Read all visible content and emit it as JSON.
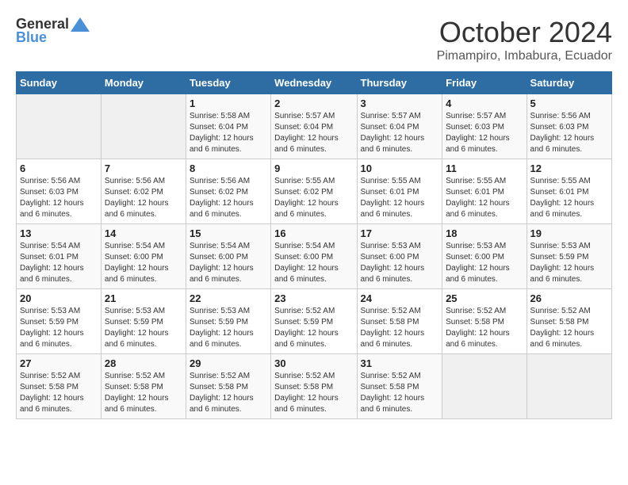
{
  "logo": {
    "general": "General",
    "blue": "Blue"
  },
  "title": "October 2024",
  "location": "Pimampiro, Imbabura, Ecuador",
  "days_header": [
    "Sunday",
    "Monday",
    "Tuesday",
    "Wednesday",
    "Thursday",
    "Friday",
    "Saturday"
  ],
  "weeks": [
    [
      {
        "day": "",
        "empty": true
      },
      {
        "day": "",
        "empty": true
      },
      {
        "day": "1",
        "sunrise": "Sunrise: 5:58 AM",
        "sunset": "Sunset: 6:04 PM",
        "daylight": "Daylight: 12 hours and 6 minutes."
      },
      {
        "day": "2",
        "sunrise": "Sunrise: 5:57 AM",
        "sunset": "Sunset: 6:04 PM",
        "daylight": "Daylight: 12 hours and 6 minutes."
      },
      {
        "day": "3",
        "sunrise": "Sunrise: 5:57 AM",
        "sunset": "Sunset: 6:04 PM",
        "daylight": "Daylight: 12 hours and 6 minutes."
      },
      {
        "day": "4",
        "sunrise": "Sunrise: 5:57 AM",
        "sunset": "Sunset: 6:03 PM",
        "daylight": "Daylight: 12 hours and 6 minutes."
      },
      {
        "day": "5",
        "sunrise": "Sunrise: 5:56 AM",
        "sunset": "Sunset: 6:03 PM",
        "daylight": "Daylight: 12 hours and 6 minutes."
      }
    ],
    [
      {
        "day": "6",
        "sunrise": "Sunrise: 5:56 AM",
        "sunset": "Sunset: 6:03 PM",
        "daylight": "Daylight: 12 hours and 6 minutes."
      },
      {
        "day": "7",
        "sunrise": "Sunrise: 5:56 AM",
        "sunset": "Sunset: 6:02 PM",
        "daylight": "Daylight: 12 hours and 6 minutes."
      },
      {
        "day": "8",
        "sunrise": "Sunrise: 5:56 AM",
        "sunset": "Sunset: 6:02 PM",
        "daylight": "Daylight: 12 hours and 6 minutes."
      },
      {
        "day": "9",
        "sunrise": "Sunrise: 5:55 AM",
        "sunset": "Sunset: 6:02 PM",
        "daylight": "Daylight: 12 hours and 6 minutes."
      },
      {
        "day": "10",
        "sunrise": "Sunrise: 5:55 AM",
        "sunset": "Sunset: 6:01 PM",
        "daylight": "Daylight: 12 hours and 6 minutes."
      },
      {
        "day": "11",
        "sunrise": "Sunrise: 5:55 AM",
        "sunset": "Sunset: 6:01 PM",
        "daylight": "Daylight: 12 hours and 6 minutes."
      },
      {
        "day": "12",
        "sunrise": "Sunrise: 5:55 AM",
        "sunset": "Sunset: 6:01 PM",
        "daylight": "Daylight: 12 hours and 6 minutes."
      }
    ],
    [
      {
        "day": "13",
        "sunrise": "Sunrise: 5:54 AM",
        "sunset": "Sunset: 6:01 PM",
        "daylight": "Daylight: 12 hours and 6 minutes."
      },
      {
        "day": "14",
        "sunrise": "Sunrise: 5:54 AM",
        "sunset": "Sunset: 6:00 PM",
        "daylight": "Daylight: 12 hours and 6 minutes."
      },
      {
        "day": "15",
        "sunrise": "Sunrise: 5:54 AM",
        "sunset": "Sunset: 6:00 PM",
        "daylight": "Daylight: 12 hours and 6 minutes."
      },
      {
        "day": "16",
        "sunrise": "Sunrise: 5:54 AM",
        "sunset": "Sunset: 6:00 PM",
        "daylight": "Daylight: 12 hours and 6 minutes."
      },
      {
        "day": "17",
        "sunrise": "Sunrise: 5:53 AM",
        "sunset": "Sunset: 6:00 PM",
        "daylight": "Daylight: 12 hours and 6 minutes."
      },
      {
        "day": "18",
        "sunrise": "Sunrise: 5:53 AM",
        "sunset": "Sunset: 6:00 PM",
        "daylight": "Daylight: 12 hours and 6 minutes."
      },
      {
        "day": "19",
        "sunrise": "Sunrise: 5:53 AM",
        "sunset": "Sunset: 5:59 PM",
        "daylight": "Daylight: 12 hours and 6 minutes."
      }
    ],
    [
      {
        "day": "20",
        "sunrise": "Sunrise: 5:53 AM",
        "sunset": "Sunset: 5:59 PM",
        "daylight": "Daylight: 12 hours and 6 minutes."
      },
      {
        "day": "21",
        "sunrise": "Sunrise: 5:53 AM",
        "sunset": "Sunset: 5:59 PM",
        "daylight": "Daylight: 12 hours and 6 minutes."
      },
      {
        "day": "22",
        "sunrise": "Sunrise: 5:53 AM",
        "sunset": "Sunset: 5:59 PM",
        "daylight": "Daylight: 12 hours and 6 minutes."
      },
      {
        "day": "23",
        "sunrise": "Sunrise: 5:52 AM",
        "sunset": "Sunset: 5:59 PM",
        "daylight": "Daylight: 12 hours and 6 minutes."
      },
      {
        "day": "24",
        "sunrise": "Sunrise: 5:52 AM",
        "sunset": "Sunset: 5:58 PM",
        "daylight": "Daylight: 12 hours and 6 minutes."
      },
      {
        "day": "25",
        "sunrise": "Sunrise: 5:52 AM",
        "sunset": "Sunset: 5:58 PM",
        "daylight": "Daylight: 12 hours and 6 minutes."
      },
      {
        "day": "26",
        "sunrise": "Sunrise: 5:52 AM",
        "sunset": "Sunset: 5:58 PM",
        "daylight": "Daylight: 12 hours and 6 minutes."
      }
    ],
    [
      {
        "day": "27",
        "sunrise": "Sunrise: 5:52 AM",
        "sunset": "Sunset: 5:58 PM",
        "daylight": "Daylight: 12 hours and 6 minutes."
      },
      {
        "day": "28",
        "sunrise": "Sunrise: 5:52 AM",
        "sunset": "Sunset: 5:58 PM",
        "daylight": "Daylight: 12 hours and 6 minutes."
      },
      {
        "day": "29",
        "sunrise": "Sunrise: 5:52 AM",
        "sunset": "Sunset: 5:58 PM",
        "daylight": "Daylight: 12 hours and 6 minutes."
      },
      {
        "day": "30",
        "sunrise": "Sunrise: 5:52 AM",
        "sunset": "Sunset: 5:58 PM",
        "daylight": "Daylight: 12 hours and 6 minutes."
      },
      {
        "day": "31",
        "sunrise": "Sunrise: 5:52 AM",
        "sunset": "Sunset: 5:58 PM",
        "daylight": "Daylight: 12 hours and 6 minutes."
      },
      {
        "day": "",
        "empty": true
      },
      {
        "day": "",
        "empty": true
      }
    ]
  ]
}
